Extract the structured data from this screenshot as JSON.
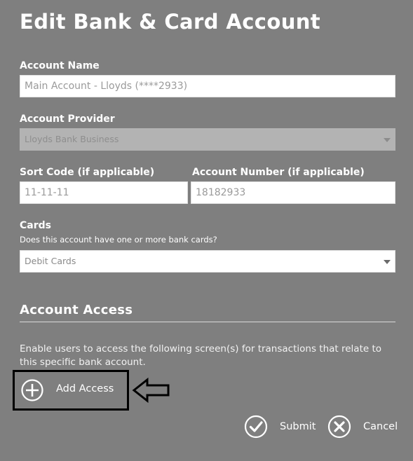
{
  "page": {
    "title": "Edit Bank & Card Account"
  },
  "account_name": {
    "label": "Account Name",
    "value": "Main Account - Lloyds (****2933)"
  },
  "provider": {
    "label": "Account Provider",
    "value": "Lloyds Bank Business"
  },
  "sort_code": {
    "label": "Sort Code (if applicable)",
    "value": "11-11-11"
  },
  "account_number": {
    "label": "Account Number (if applicable)",
    "value": "18182933"
  },
  "cards": {
    "label": "Cards",
    "help": "Does this account have one or more bank cards?",
    "value": "Debit Cards"
  },
  "access": {
    "title": "Account Access",
    "description": "Enable users to access the following screen(s) for transactions that relate to this specific bank account.",
    "add_label": "Add Access"
  },
  "actions": {
    "submit": "Submit",
    "cancel": "Cancel"
  },
  "icons": {
    "add": "plus-circle-icon",
    "submit": "check-circle-icon",
    "cancel": "x-circle-icon",
    "pointer": "left-arrow-icon"
  }
}
